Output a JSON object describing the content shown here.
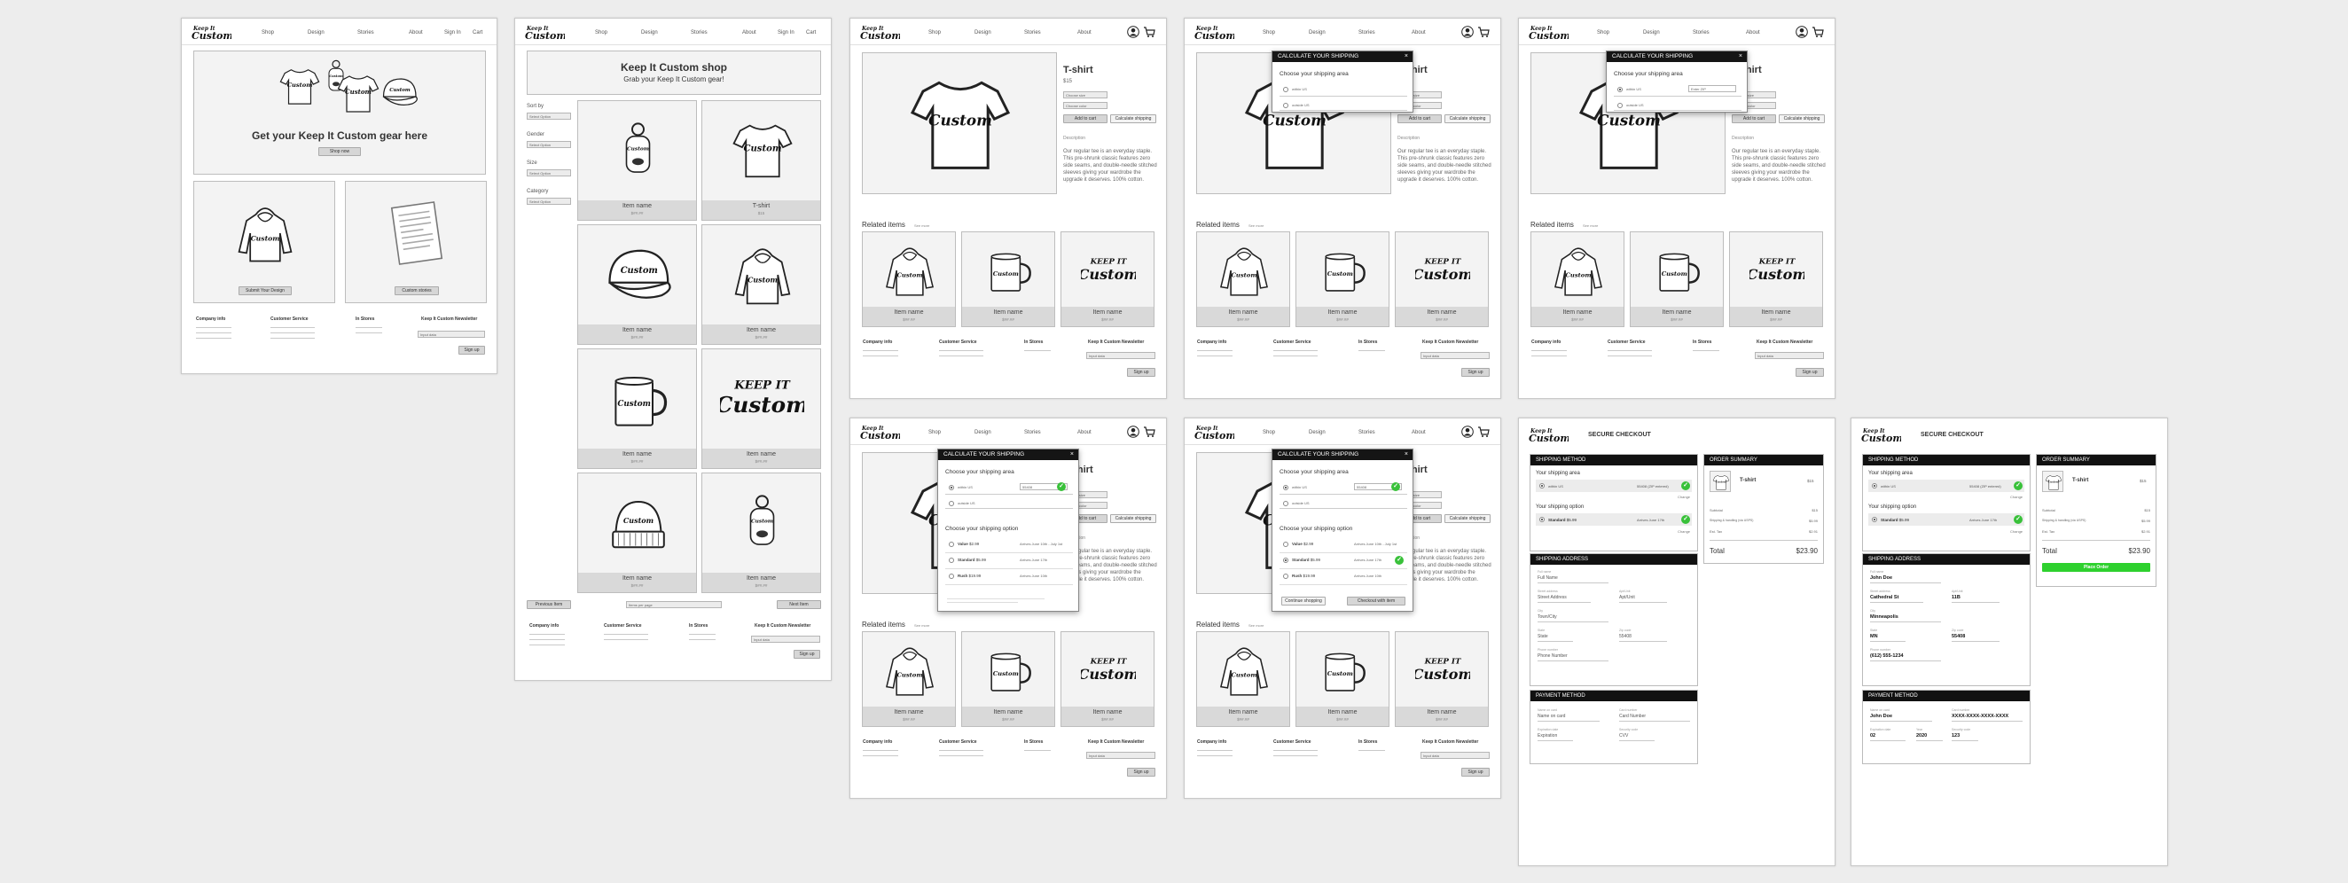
{
  "nav": {
    "shop": "Shop",
    "design": "Design",
    "stories": "Stories",
    "about": "About",
    "signin": "Sign In",
    "cart": "Cart"
  },
  "home": {
    "hero_title": "Get your Keep It Custom gear here",
    "shop_btn": "Shop now",
    "design_btn": "Submit Your Design",
    "stories_btn": "Custom stories"
  },
  "footer": {
    "company": "Company info",
    "service": "Customer Service",
    "stores": "In Stores",
    "newsletter": "Keep It Custom Newsletter",
    "email_placeholder": "Input data",
    "signup": "Sign up"
  },
  "shop": {
    "title": "Keep It Custom shop",
    "subtitle": "Grab your Keep It Custom gear!",
    "filters": [
      {
        "label": "Sort by"
      },
      {
        "label": "Gender"
      },
      {
        "label": "Size"
      },
      {
        "label": "Category"
      }
    ],
    "select_default": "Select Option",
    "items": [
      {
        "name": "Item name",
        "price": "$##.##"
      },
      {
        "name": "T-shirt",
        "price": "$15"
      },
      {
        "name": "Item name",
        "price": "$##.##"
      },
      {
        "name": "Item name",
        "price": "$##.##"
      },
      {
        "name": "Item name",
        "price": "$##.##"
      },
      {
        "name": "Item name",
        "price": "$##.##"
      },
      {
        "name": "Item name",
        "price": "$##.##"
      },
      {
        "name": "Item name",
        "price": "$##.##"
      }
    ],
    "prev": "Previous Item",
    "page": "Items per page",
    "next": "Next Item"
  },
  "product": {
    "title": "T-shirt",
    "price": "$15",
    "size": "Choose size",
    "color": "Choose color",
    "add": "Add to cart",
    "calc": "Calculate shipping",
    "desc_label": "Description",
    "desc": "Our regular tee is an everyday staple. This pre-shrunk classic features zero side seams, and double-needle stitched sleeves giving your wardrobe the upgrade it deserves. 100% cotton.",
    "related": "Related items",
    "see_more": "See more",
    "related_items": [
      {
        "name": "Item name",
        "price": "$##.##"
      },
      {
        "name": "Item name",
        "price": "$##.##"
      },
      {
        "name": "Item name",
        "price": "$##.##"
      }
    ]
  },
  "modal": {
    "title": "CALCULATE YOUR SHIPPING",
    "area": "Choose your shipping area",
    "within": "within US",
    "outside": "outside US",
    "zip": "Enter ZIP",
    "zip_value": "55408",
    "option": "Choose your shipping option",
    "options": [
      {
        "name": "Value",
        "price": "$2.99",
        "eta": "Arrives June 10th - July 1st"
      },
      {
        "name": "Standard",
        "price": "$5.99",
        "eta": "Arrives June 17th"
      },
      {
        "name": "Rush",
        "price": "$19.99",
        "eta": "Arrives June 10th"
      }
    ],
    "continue": "Continue shopping",
    "checkout": "Checkout with item"
  },
  "checkout": {
    "title": "SECURE CHECKOUT",
    "shipping_method": "SHIPPING METHOD",
    "area_label": "Your shipping area",
    "option_label": "Your shipping option",
    "change": "Change",
    "within": "within US",
    "zip": "55408 (ZIP entered)",
    "std": "Standard",
    "std_price": "$5.99",
    "std_eta": "Arrives June 17th",
    "address_head": "SHIPPING ADDRESS",
    "payment_head": "PAYMENT METHOD",
    "summary_head": "ORDER SUMMARY",
    "item": "T-shirt",
    "item_price": "$15",
    "subtotal": "Subtotal",
    "subtotal_v": "$15",
    "ship": "Shipping & handling (via USPS)",
    "ship_v": "$5.99",
    "tax": "Est. Tax",
    "tax_v": "$2.91",
    "total": "Total",
    "total_v": "$23.90",
    "place_order": "Place Order",
    "fields_empty": [
      {
        "l": "Full name",
        "v": "Full Name"
      },
      {
        "l": "Street address",
        "v": "Street Address"
      },
      {
        "l": "Apt/Unit",
        "v": "Apt/Unit"
      },
      {
        "l": "City",
        "v": "Town/City"
      },
      {
        "l": "State",
        "v": "State"
      },
      {
        "l": "Zip code",
        "v": "55408"
      },
      {
        "l": "Phone number",
        "v": "Phone Number"
      }
    ],
    "fields_filled": [
      {
        "l": "Full name",
        "v": "John Doe"
      },
      {
        "l": "Street address",
        "v": "Cathedral St"
      },
      {
        "l": "Apt/Unit",
        "v": "11B"
      },
      {
        "l": "City",
        "v": "Minneapolis"
      },
      {
        "l": "State",
        "v": "MN"
      },
      {
        "l": "Zip code",
        "v": "55408"
      },
      {
        "l": "Phone number",
        "v": "(612) 555-1234"
      }
    ],
    "pay_empty": [
      {
        "l": "Name on card",
        "v": "Name on card"
      },
      {
        "l": "Card number",
        "v": "Card Number"
      },
      {
        "l": "Expiration date",
        "v": "Expiration"
      },
      {
        "l": "Security code",
        "v": "CVV"
      }
    ],
    "pay_filled": [
      {
        "l": "Name on card",
        "v": "John Doe"
      },
      {
        "l": "Card number",
        "v": "XXXX-XXXX-XXXX-XXXX"
      },
      {
        "l": "Expiration date",
        "v": "02"
      },
      {
        "l": "Year",
        "v": "2020"
      },
      {
        "l": "Security code",
        "v": "123"
      }
    ]
  }
}
